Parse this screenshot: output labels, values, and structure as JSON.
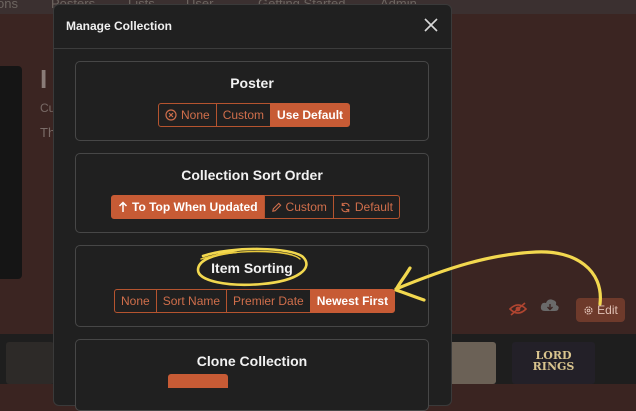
{
  "nav": {
    "items": [
      "ons",
      "Posters",
      "Lists",
      "User",
      "Getting Started",
      "Admin"
    ]
  },
  "background": {
    "title": "I",
    "sub1": "Cu",
    "sub2": "Th",
    "edit_label": "Edit",
    "thumb_text": [
      "LORD",
      "RINGS"
    ]
  },
  "modal": {
    "title": "Manage Collection",
    "sections": {
      "poster": {
        "title": "Poster",
        "options": [
          "None",
          "Custom",
          "Use Default"
        ],
        "selected": "Use Default"
      },
      "sort_order": {
        "title": "Collection Sort Order",
        "options": [
          "To Top When Updated",
          "Custom",
          "Default"
        ],
        "selected": "To Top When Updated"
      },
      "item_sorting": {
        "title": "Item Sorting",
        "options": [
          "None",
          "Sort Name",
          "Premier Date",
          "Newest First"
        ],
        "selected": "Newest First"
      },
      "clone": {
        "title": "Clone Collection"
      }
    }
  },
  "colors": {
    "accent": "#c75b35",
    "annotation": "#f2d84f"
  }
}
